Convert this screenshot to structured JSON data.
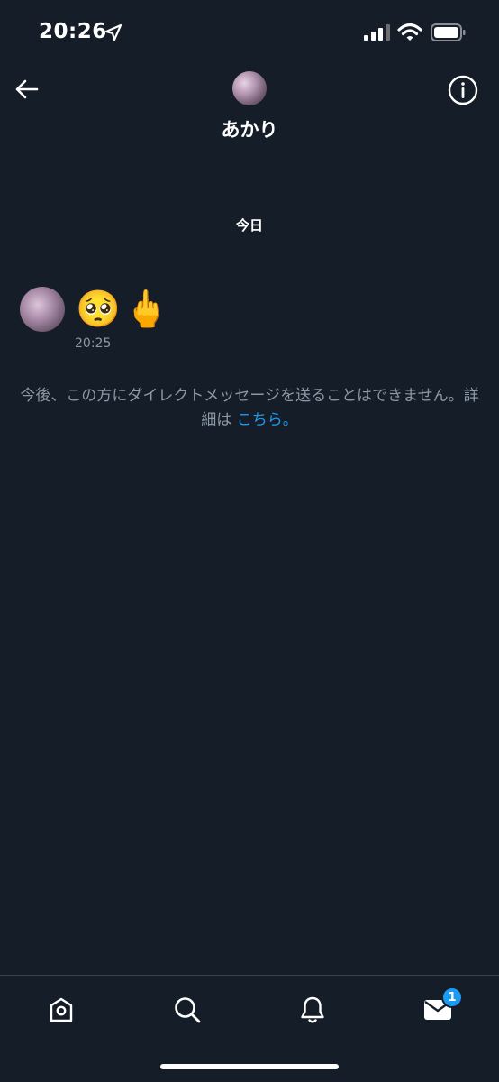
{
  "status_bar": {
    "time": "20:26",
    "icons": [
      "location-arrow-icon",
      "signal-icon",
      "wifi-icon",
      "battery-icon"
    ]
  },
  "header": {
    "name": "あかり",
    "back_icon": "arrow-left-icon",
    "info_icon": "info-icon"
  },
  "conversation": {
    "date_label": "今日",
    "messages": [
      {
        "content": "🥺🖕",
        "time": "20:25"
      }
    ],
    "notice": {
      "text": "今後、この方にダイレクトメッセージを送ることはできません。詳細は ",
      "link": "こちら。"
    }
  },
  "bottom_nav": {
    "items": [
      "home-icon",
      "search-icon",
      "bell-icon",
      "mail-icon"
    ],
    "mail_badge": "1"
  },
  "colors": {
    "background": "#151d28",
    "muted_text": "#8b98a5",
    "accent": "#1d9bf0"
  }
}
